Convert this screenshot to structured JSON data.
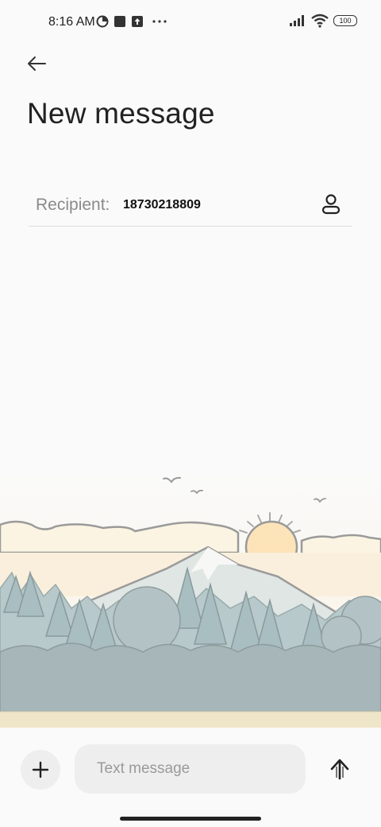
{
  "status_bar": {
    "time": "8:16 AM",
    "battery": "100",
    "icons": [
      "data-saver-icon",
      "square-app-icon",
      "upload-icon",
      "more-dots-icon",
      "signal-icon",
      "wifi-icon",
      "battery-icon"
    ]
  },
  "header": {
    "back_icon": "arrow-left-icon",
    "title": "New message"
  },
  "recipient": {
    "label": "Recipient:",
    "value": "18730218809",
    "contact_icon": "person-icon"
  },
  "composer": {
    "add_icon": "plus-icon",
    "placeholder": "Text message",
    "send_icon": "arrow-up-icon"
  },
  "colors": {
    "background": "#fafafa",
    "input_bg": "#eeeeee",
    "sun": "#fde3b8",
    "trees": "#aebfc2",
    "ground": "#efe5c8"
  }
}
